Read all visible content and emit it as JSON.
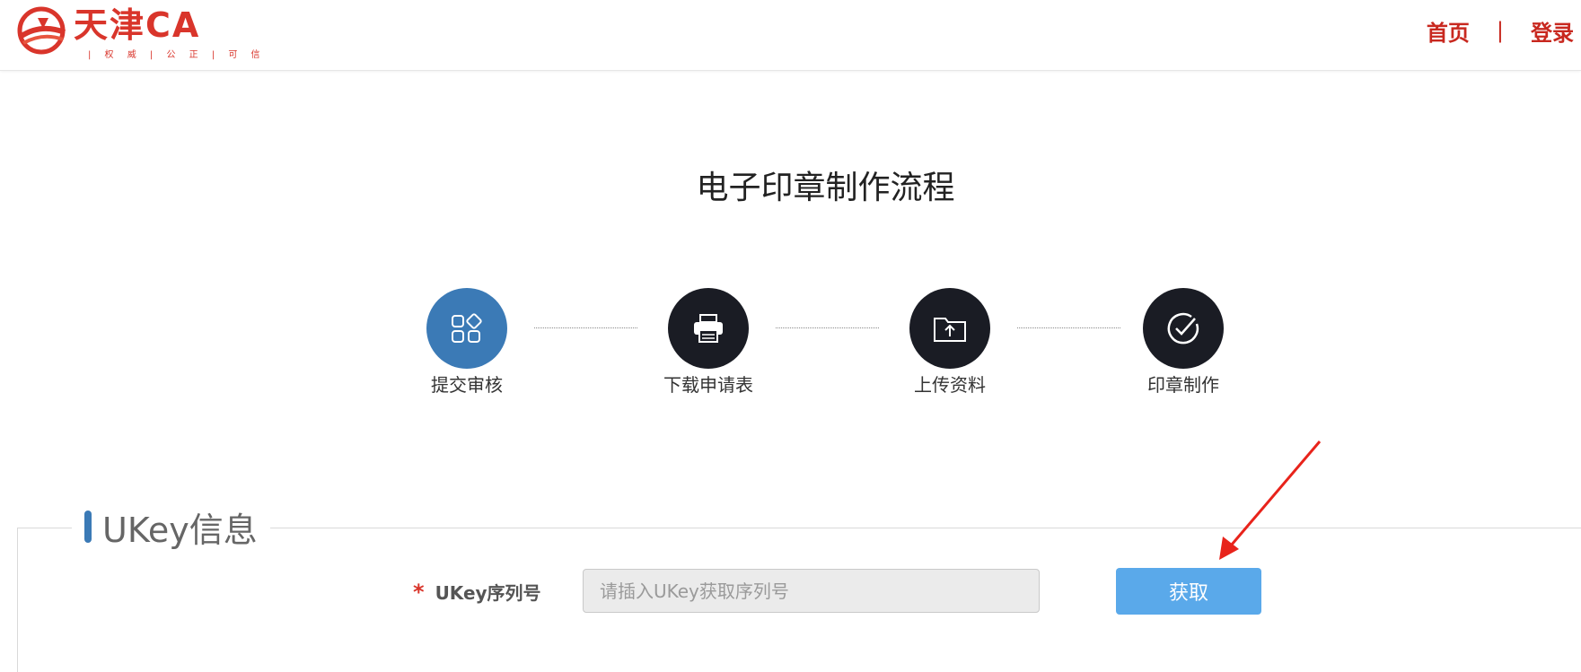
{
  "header": {
    "logo_text": "天津CA",
    "logo_subtitle": "| 权 威 | 公 正 | 可 信",
    "nav": {
      "home": "首页",
      "separator": "|",
      "login": "登录"
    }
  },
  "page": {
    "title": "电子印章制作流程"
  },
  "steps": [
    {
      "label": "提交审核",
      "icon": "apps-icon",
      "active": true
    },
    {
      "label": "下载申请表",
      "icon": "printer-icon",
      "active": false
    },
    {
      "label": "上传资料",
      "icon": "folder-upload-icon",
      "active": false
    },
    {
      "label": "印章制作",
      "icon": "check-circle-icon",
      "active": false
    }
  ],
  "ukey_section": {
    "legend": "UKey信息",
    "field_required_mark": "*",
    "field_label": "UKey序列号",
    "field_value": "",
    "field_placeholder": "请插入UKey获取序列号",
    "button_label": "获取"
  },
  "colors": {
    "brand_red": "#c8281f",
    "active_step": "#3b7ab6",
    "inactive_step": "#1a1c24",
    "button": "#5aa9ea",
    "annotation_arrow": "#e8231b"
  }
}
